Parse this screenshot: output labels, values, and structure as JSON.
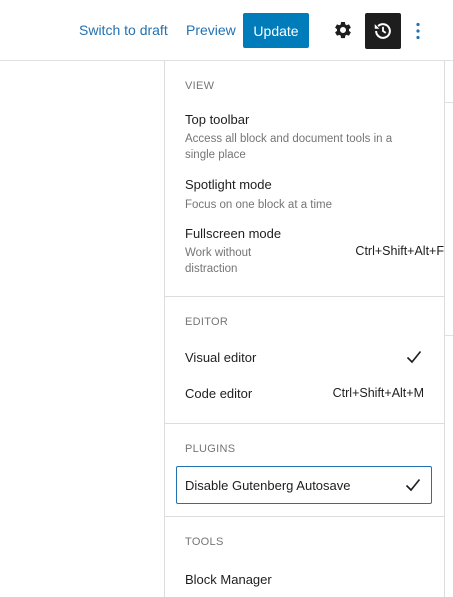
{
  "header": {
    "switch_to_draft": "Switch to draft",
    "preview": "Preview",
    "update": "Update"
  },
  "menu": {
    "view": {
      "title": "VIEW",
      "items": [
        {
          "label": "Top toolbar",
          "description": "Access all block and document tools in a single place"
        },
        {
          "label": "Spotlight mode",
          "description": "Focus on one block at a time"
        },
        {
          "label": "Fullscreen mode",
          "description": "Work without distraction",
          "shortcut": "Ctrl+Shift+Alt+F"
        }
      ]
    },
    "editor": {
      "title": "EDITOR",
      "items": [
        {
          "label": "Visual editor",
          "checked": true
        },
        {
          "label": "Code editor",
          "shortcut": "Ctrl+Shift+Alt+M"
        }
      ]
    },
    "plugins": {
      "title": "PLUGINS",
      "items": [
        {
          "label": "Disable Gutenberg Autosave",
          "checked": true
        }
      ]
    },
    "tools": {
      "title": "TOOLS",
      "items": [
        {
          "label": "Block Manager"
        }
      ]
    }
  },
  "colors": {
    "accent": "#007cba",
    "link": "#2271b1",
    "dark": "#1e1e1e",
    "muted": "#757575"
  }
}
